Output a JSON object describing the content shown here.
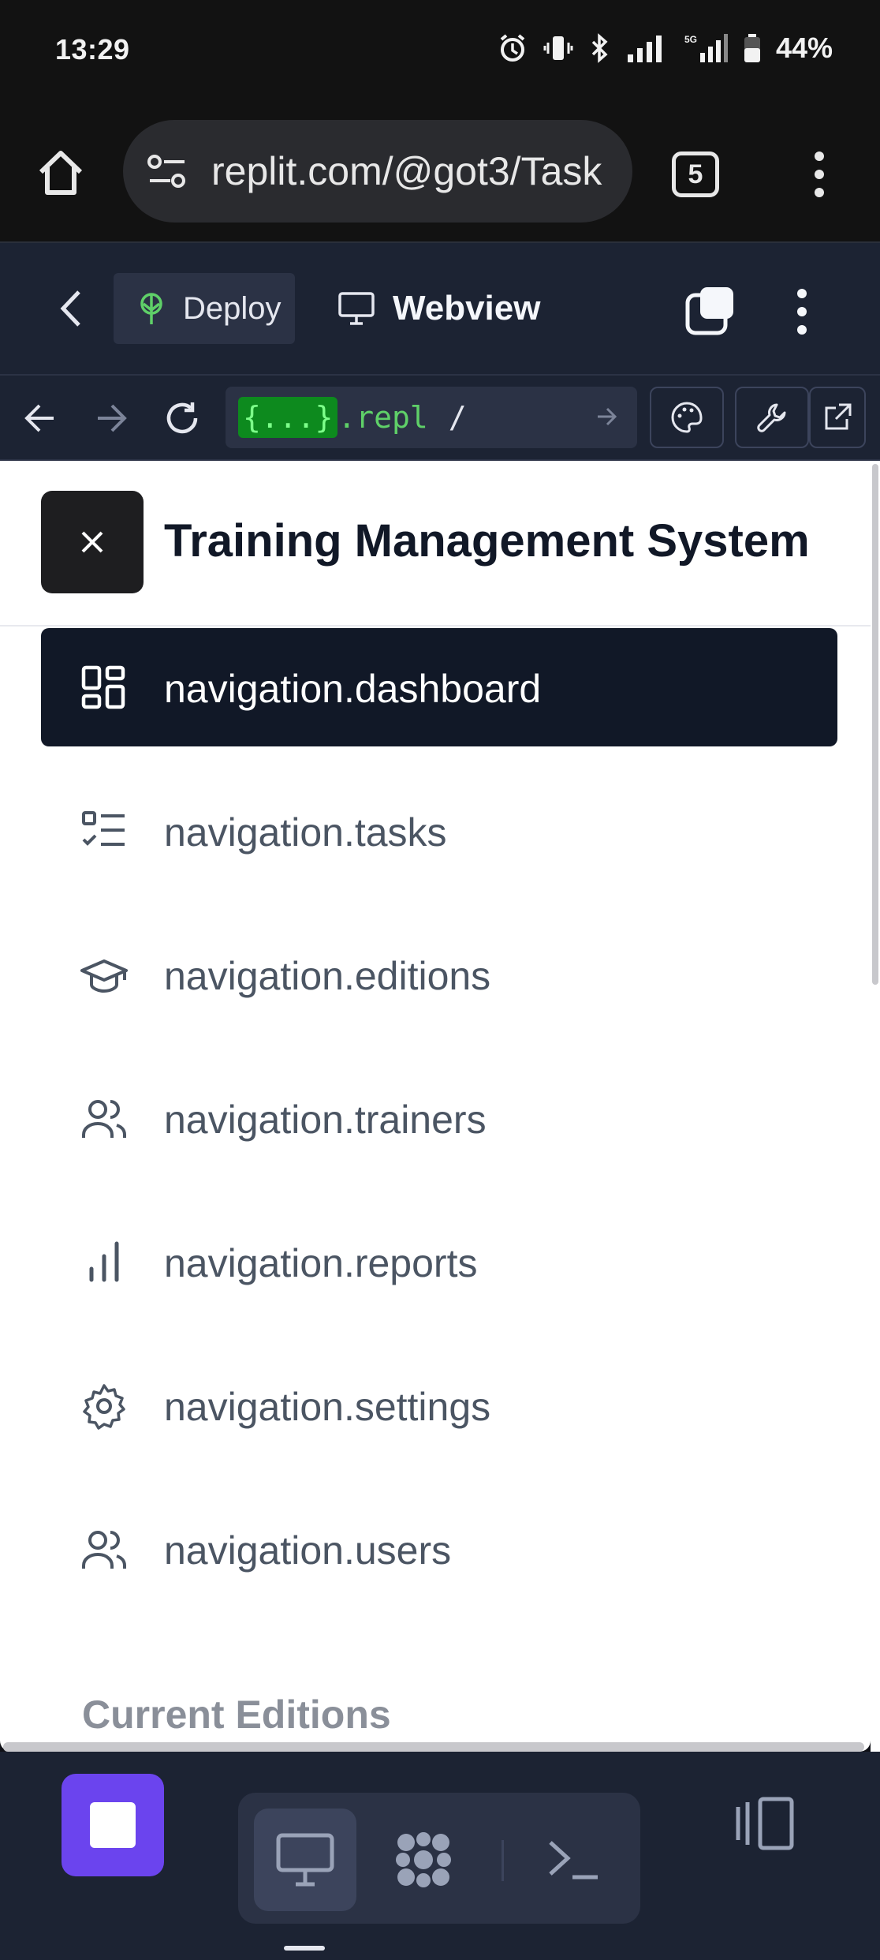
{
  "status": {
    "time": "13:29",
    "battery": "44%"
  },
  "browser": {
    "url": "replit.com/@got3/Task",
    "tab_count": "5"
  },
  "replit": {
    "deploy_label": "Deploy",
    "webview_label": "Webview",
    "address": {
      "braces": "{...}",
      "domain": ".repl",
      "path": "/"
    }
  },
  "app": {
    "title": "Training Management System",
    "nav": [
      {
        "label": "navigation.dashboard",
        "icon": "dashboard-icon",
        "active": true
      },
      {
        "label": "navigation.tasks",
        "icon": "tasks-checklist-icon",
        "active": false
      },
      {
        "label": "navigation.editions",
        "icon": "graduation-cap-icon",
        "active": false
      },
      {
        "label": "navigation.trainers",
        "icon": "users-icon",
        "active": false
      },
      {
        "label": "navigation.reports",
        "icon": "bar-chart-icon",
        "active": false
      },
      {
        "label": "navigation.settings",
        "icon": "gear-icon",
        "active": false
      },
      {
        "label": "navigation.users",
        "icon": "users-icon",
        "active": false
      }
    ],
    "section_title": "Current Editions"
  },
  "colors": {
    "accent": "#6b44ee",
    "nav_active_bg": "#111827",
    "replit_bg": "#1c2333",
    "repl_green": "#5fd068"
  }
}
